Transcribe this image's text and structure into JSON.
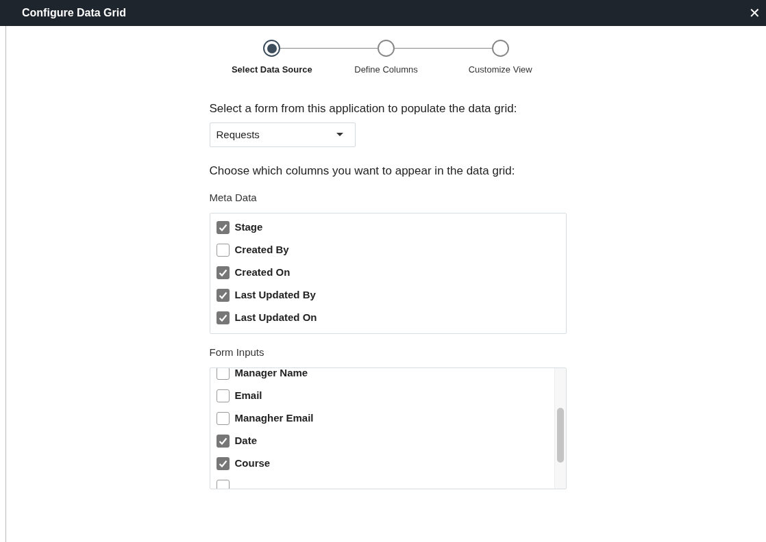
{
  "window": {
    "title": "Configure Data Grid",
    "close": "✕"
  },
  "steps": [
    {
      "label": "Select Data Source",
      "selected": true
    },
    {
      "label": "Define Columns",
      "selected": false
    },
    {
      "label": "Customize View",
      "selected": false
    }
  ],
  "form_prompt": "Select a form from this application to populate the data grid:",
  "form_select": {
    "value": "Requests"
  },
  "columns_prompt": "Choose which columns you want to appear in the data grid:",
  "meta_data": {
    "label": "Meta Data",
    "items": [
      {
        "label": "Stage",
        "checked": true
      },
      {
        "label": "Created By",
        "checked": false
      },
      {
        "label": "Created On",
        "checked": true
      },
      {
        "label": "Last Updated By",
        "checked": true
      },
      {
        "label": "Last Updated On",
        "checked": true
      }
    ]
  },
  "form_inputs": {
    "label": "Form Inputs",
    "items": [
      {
        "label": "Manager Name",
        "checked": false
      },
      {
        "label": "Email",
        "checked": false
      },
      {
        "label": "Managher Email",
        "checked": false
      },
      {
        "label": "Date",
        "checked": true
      },
      {
        "label": "Course",
        "checked": true
      },
      {
        "checked": false
      }
    ]
  }
}
